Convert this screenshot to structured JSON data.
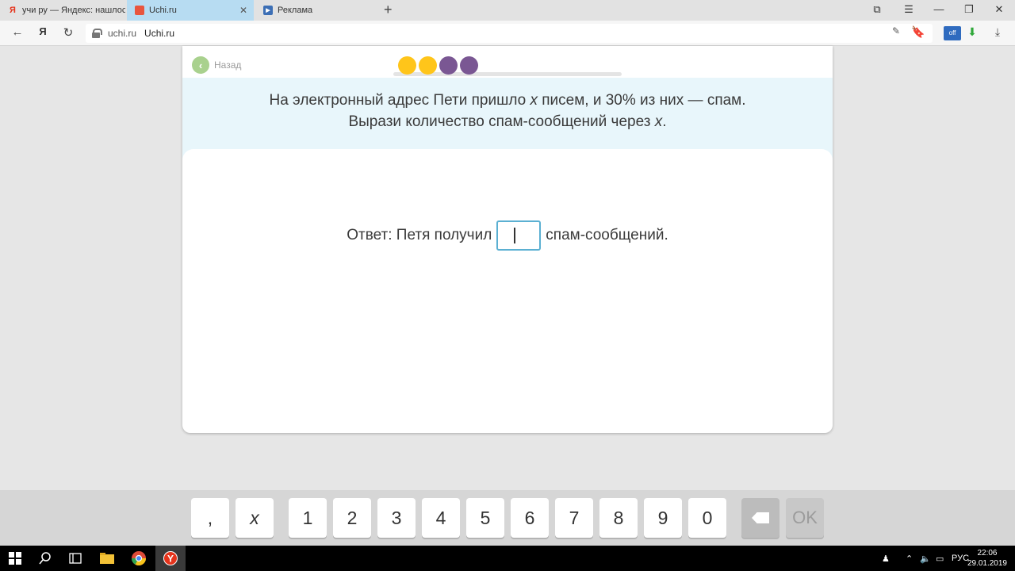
{
  "browser": {
    "tabs": [
      {
        "title": "учи ру — Яндекс: нашлось",
        "favicon": "yandex-icon",
        "active": false
      },
      {
        "title": "Uchi.ru",
        "favicon": "uchi-icon",
        "active": true
      },
      {
        "title": "Реклама",
        "favicon": "play-icon",
        "active": false
      }
    ],
    "address": {
      "domain": "uchi.ru",
      "page_title": "Uchi.ru"
    }
  },
  "lesson": {
    "back_label": "Назад",
    "progress_dots": [
      {
        "state": "done",
        "color": "#ffc51a"
      },
      {
        "state": "done",
        "color": "#ffc51a"
      },
      {
        "state": "pending",
        "color": "#7a5793"
      },
      {
        "state": "pending",
        "color": "#7a5793"
      }
    ],
    "task_line1_a": "На электронный адрес Пети пришло ",
    "task_var": "x",
    "task_line1_b": " писем, и 30% из них — спам.",
    "task_line2_a": "Вырази количество спам-сообщений через ",
    "task_line2_b": ".",
    "answer_prefix": "Ответ: Петя получил",
    "answer_value": "",
    "answer_suffix": "спам-сообщений."
  },
  "keyboard": {
    "keys": [
      ",",
      "x",
      "1",
      "2",
      "3",
      "4",
      "5",
      "6",
      "7",
      "8",
      "9",
      "0"
    ],
    "backspace_icon": "backspace-icon",
    "ok_label": "OK"
  },
  "taskbar": {
    "language": "РУС",
    "time": "22:06",
    "date": "29.01.2019"
  },
  "colors": {
    "accent": "#5bb0d2",
    "task_band": "#e8f6fb",
    "active_tab": "#b7dcf2"
  }
}
